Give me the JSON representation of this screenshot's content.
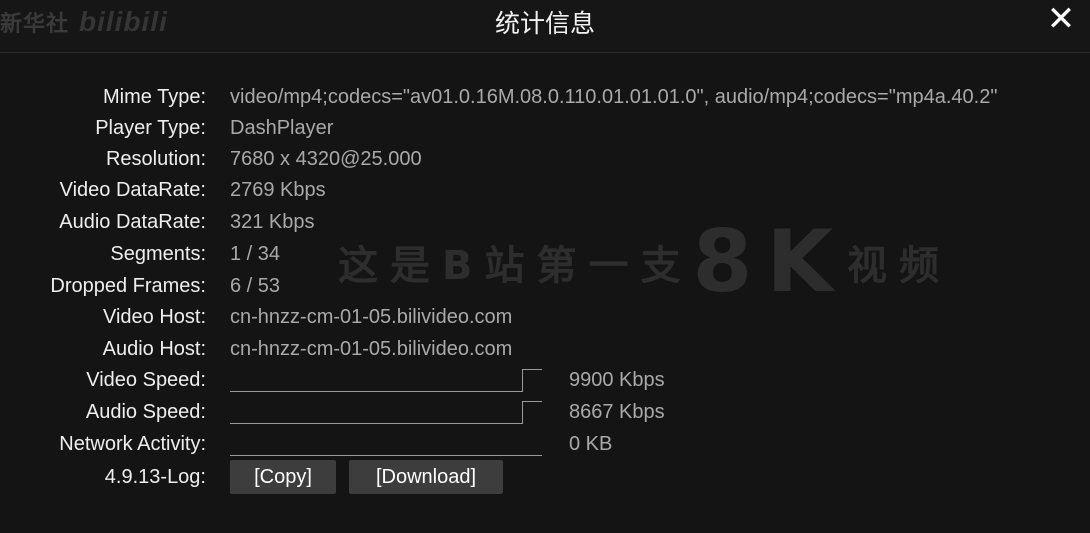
{
  "header": {
    "brand_text": "新华社",
    "brand_logo": "bilibili",
    "title": "统计信息",
    "close_label": "✕"
  },
  "watermark": {
    "text_a": "这是B站第一支",
    "text_b": "8K",
    "text_c": "视频"
  },
  "stats": {
    "mime_type": {
      "label": "Mime Type:",
      "value": "video/mp4;codecs=\"av01.0.16M.08.0.110.01.01.01.0\", audio/mp4;codecs=\"mp4a.40.2\""
    },
    "player_type": {
      "label": "Player Type:",
      "value": "DashPlayer"
    },
    "resolution": {
      "label": "Resolution:",
      "value": "7680 x 4320@25.000"
    },
    "video_datarate": {
      "label": "Video DataRate:",
      "value": "2769 Kbps"
    },
    "audio_datarate": {
      "label": "Audio DataRate:",
      "value": "321 Kbps"
    },
    "segments": {
      "label": "Segments:",
      "value": "1 / 34"
    },
    "dropped_frames": {
      "label": "Dropped Frames:",
      "value": "6 / 53"
    },
    "video_host": {
      "label": "Video Host:",
      "value": "cn-hnzz-cm-01-05.bilivideo.com"
    },
    "audio_host": {
      "label": "Audio Host:",
      "value": "cn-hnzz-cm-01-05.bilivideo.com"
    },
    "video_speed": {
      "label": "Video Speed:",
      "value": "9900 Kbps"
    },
    "audio_speed": {
      "label": "Audio Speed:",
      "value": "8667 Kbps"
    },
    "network_activity": {
      "label": "Network Activity:",
      "value": "0 KB"
    },
    "log": {
      "label": "4.9.13-Log:",
      "copy_label": "[Copy]",
      "download_label": "[Download]"
    }
  }
}
